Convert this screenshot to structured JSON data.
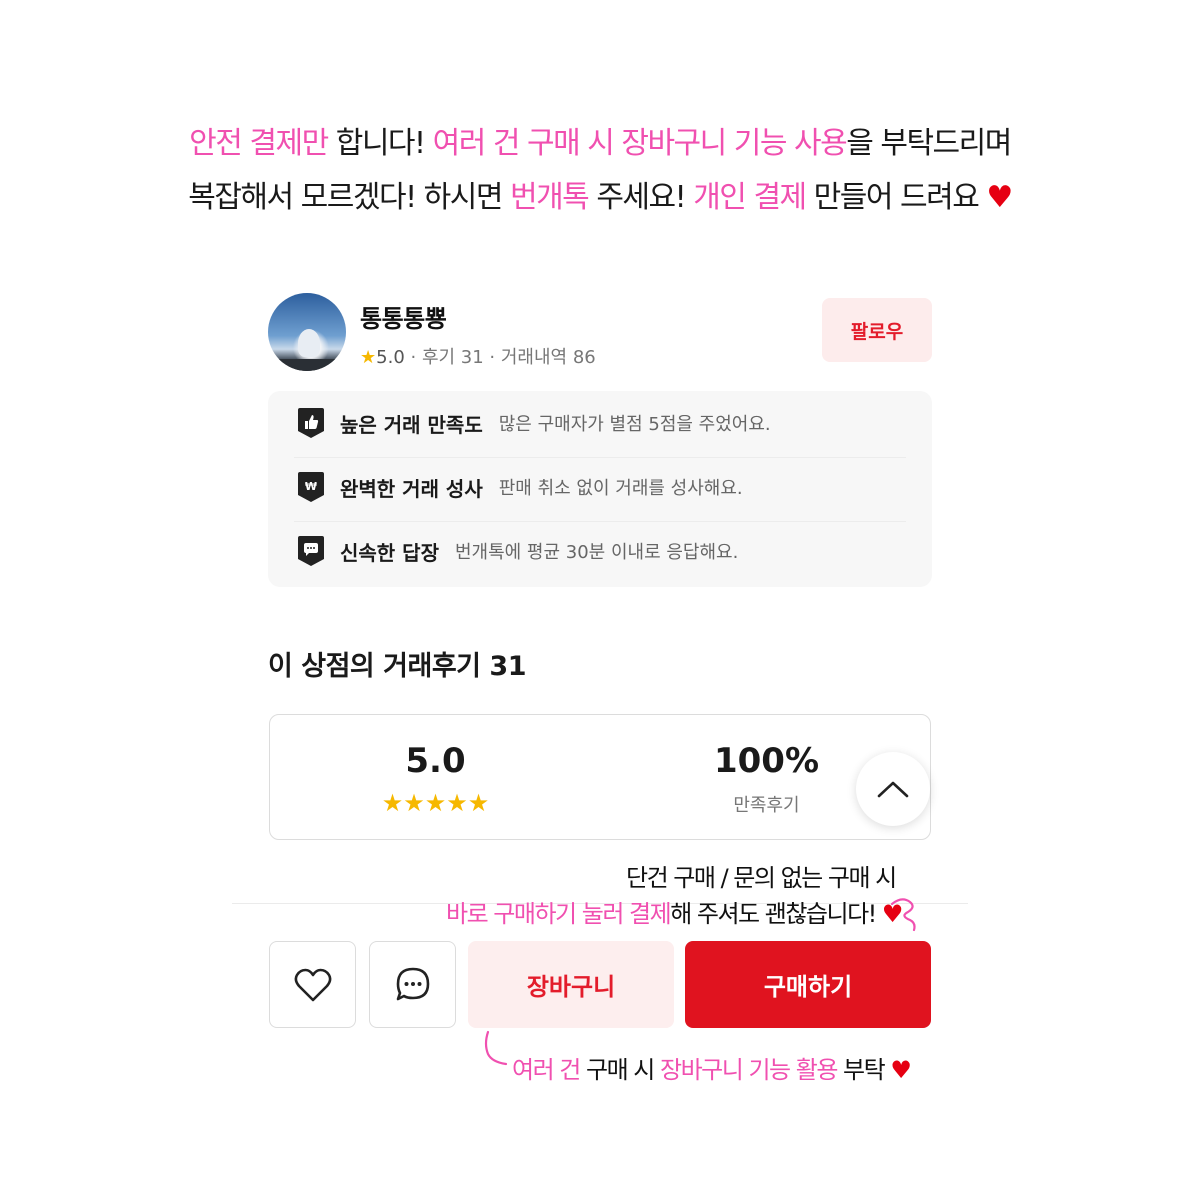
{
  "notice": {
    "line1": [
      {
        "text": "안전 결제만",
        "color": "#f050b0"
      },
      {
        "text": " 합니다! ",
        "color": "#1a1a1a"
      },
      {
        "text": "여러 건 구매 시 장바구니 기능 사용",
        "color": "#f050b0"
      },
      {
        "text": "을 부탁드리며",
        "color": "#1a1a1a"
      }
    ],
    "line2": [
      {
        "text": "복잡해서 모르겠다! 하시면 ",
        "color": "#1a1a1a"
      },
      {
        "text": "번개톡",
        "color": "#f050b0"
      },
      {
        "text": " 주세요! ",
        "color": "#1a1a1a"
      },
      {
        "text": "개인 결제",
        "color": "#f050b0"
      },
      {
        "text": " 만들어 드려요 ",
        "color": "#1a1a1a"
      },
      {
        "text": "♥",
        "color": "#e60012"
      }
    ]
  },
  "shop": {
    "name": "통통통뿅",
    "star": "★",
    "rating": "5.0",
    "stats_rest": " · 후기 31 · 거래내역 86",
    "follow_label": "팔로우"
  },
  "features": [
    {
      "icon": "thumbs-up-icon",
      "title": "높은 거래 만족도",
      "desc": "많은 구매자가 별점 5점을 주었어요."
    },
    {
      "icon": "won-icon",
      "title": "완벽한 거래 성사",
      "desc": "판매 취소 없이 거래를 성사해요."
    },
    {
      "icon": "chat-bubble-icon",
      "title": "신속한 답장",
      "desc": "번개톡에 평균 30분 이내로 응답해요."
    }
  ],
  "reviews": {
    "title": "이 상점의 거래후기 31",
    "score": "5.0",
    "stars": "★★★★★",
    "rating_fraction": 1.0,
    "satisfaction": "100%",
    "satisfaction_label": "만족후기"
  },
  "annotations": {
    "note1": "단건 구매 / 문의 없는 구매 시",
    "note2": [
      {
        "text": "바로 구매하기 눌러 결제",
        "color": "#f050b0"
      },
      {
        "text": "해 주셔도 괜찮습니다! ",
        "color": "#111111"
      },
      {
        "text": "♥",
        "color": "#e60012"
      }
    ],
    "note3": [
      {
        "text": "여러 건 ",
        "color": "#f050b0"
      },
      {
        "text": "구매 시 ",
        "color": "#111111"
      },
      {
        "text": "장바구니 기능 활용",
        "color": "#f050b0"
      },
      {
        "text": " 부탁 ",
        "color": "#111111"
      },
      {
        "text": "♥",
        "color": "#e60012"
      }
    ]
  },
  "actions": {
    "cart_label": "장바구니",
    "buy_label": "구매하기"
  },
  "colors": {
    "accent_pink": "#f050b0",
    "brand_red": "#e0131f",
    "star_yellow": "#f6b800",
    "heart_red": "#e60012"
  }
}
